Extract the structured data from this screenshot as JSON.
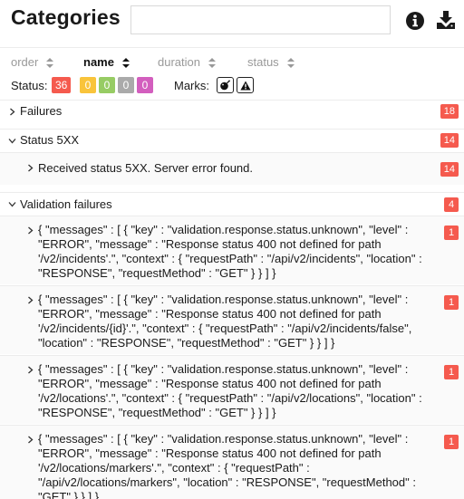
{
  "header": {
    "title": "Categories",
    "search_value": "",
    "info_icon": "info-circle-icon",
    "download_icon": "download-icon"
  },
  "sorters": [
    {
      "label": "order",
      "active": false
    },
    {
      "label": "name",
      "active": true
    },
    {
      "label": "duration",
      "active": false
    },
    {
      "label": "status",
      "active": false
    }
  ],
  "status_filter": {
    "label": "Status:",
    "badges": [
      {
        "value": "36",
        "color": "#f55a4e",
        "meaning": "failed"
      },
      {
        "value": "0",
        "color": "#f9c43b",
        "meaning": "broken"
      },
      {
        "value": "0",
        "color": "#97cc64",
        "meaning": "passed"
      },
      {
        "value": "0",
        "color": "#aaaaaa",
        "meaning": "skipped"
      },
      {
        "value": "0",
        "color": "#d35ebe",
        "meaning": "unknown"
      }
    ]
  },
  "marks": {
    "label": "Marks:",
    "items": [
      "bomb-icon",
      "warning-triangle-icon"
    ]
  },
  "tree": {
    "failures": {
      "label": "Failures",
      "count": "18",
      "expanded": false
    },
    "status5xx": {
      "label": "Status 5XX",
      "count": "14",
      "expanded": true
    },
    "status5xx_child": {
      "label": "Received status 5XX. Server error found.",
      "count": "14"
    },
    "validation": {
      "label": "Validation failures",
      "count": "4",
      "expanded": true
    },
    "validation_children": [
      {
        "lines": [
          "{ \"messages\" : [ { \"key\" : \"validation.response.status.unknown\", \"level\" :",
          "\"ERROR\", \"message\" : \"Response status 400 not defined for path",
          "'/v2/incidents'.\", \"context\" : { \"requestPath\" : \"/api/v2/incidents\", \"location\" :",
          "\"RESPONSE\", \"requestMethod\" : \"GET\" } } ] }"
        ],
        "count": "1"
      },
      {
        "lines": [
          "{ \"messages\" : [ { \"key\" : \"validation.response.status.unknown\", \"level\" :",
          "\"ERROR\", \"message\" : \"Response status 400 not defined for path",
          "'/v2/incidents/{id}'.\", \"context\" : { \"requestPath\" : \"/api/v2/incidents/false\",",
          "\"location\" : \"RESPONSE\", \"requestMethod\" : \"GET\" } } ] }"
        ],
        "count": "1"
      },
      {
        "lines": [
          "{ \"messages\" : [ { \"key\" : \"validation.response.status.unknown\", \"level\" :",
          "\"ERROR\", \"message\" : \"Response status 400 not defined for path",
          "'/v2/locations'.\", \"context\" : { \"requestPath\" : \"/api/v2/locations\", \"location\" :",
          "\"RESPONSE\", \"requestMethod\" : \"GET\" } } ] }"
        ],
        "count": "1"
      },
      {
        "lines": [
          "{ \"messages\" : [ { \"key\" : \"validation.response.status.unknown\", \"level\" :",
          "\"ERROR\", \"message\" : \"Response status 400 not defined for path",
          "'/v2/locations/markers'.\", \"context\" : { \"requestPath\" :",
          "\"/api/v2/locations/markers\", \"location\" : \"RESPONSE\", \"requestMethod\" :",
          "\"GET\" } } ] }"
        ],
        "count": "1"
      }
    ]
  }
}
